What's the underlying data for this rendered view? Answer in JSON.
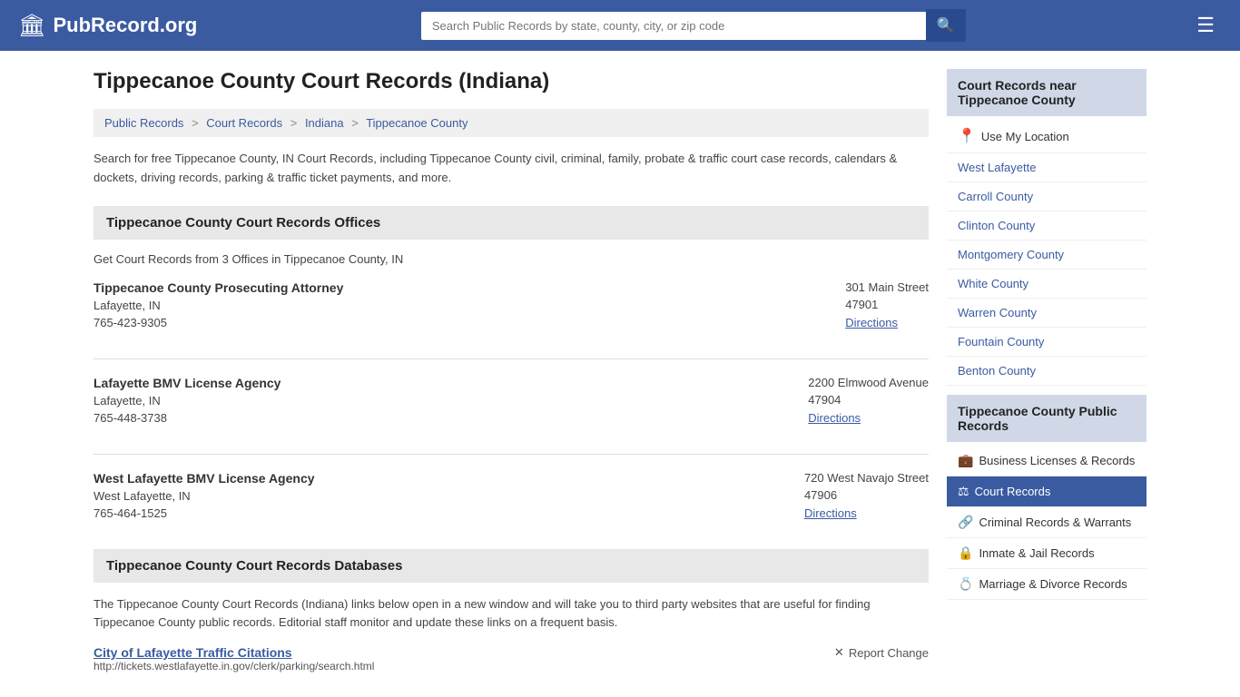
{
  "header": {
    "logo_icon": "🏛",
    "logo_text": "PubRecord.org",
    "search_placeholder": "Search Public Records by state, county, city, or zip code",
    "search_icon": "🔍",
    "menu_icon": "☰"
  },
  "page": {
    "title": "Tippecanoe County Court Records (Indiana)",
    "breadcrumb": [
      {
        "label": "Public Records",
        "href": "#"
      },
      {
        "label": "Court Records",
        "href": "#"
      },
      {
        "label": "Indiana",
        "href": "#"
      },
      {
        "label": "Tippecanoe County",
        "href": "#"
      }
    ],
    "description": "Search for free Tippecanoe County, IN Court Records, including Tippecanoe County civil, criminal, family, probate & traffic court case records, calendars & dockets, driving records, parking & traffic ticket payments, and more."
  },
  "offices_section": {
    "heading": "Tippecanoe County Court Records Offices",
    "count_text": "Get Court Records from 3 Offices in Tippecanoe County, IN",
    "offices": [
      {
        "name": "Tippecanoe County Prosecuting Attorney",
        "city": "Lafayette, IN",
        "phone": "765-423-9305",
        "address": "301 Main Street",
        "zip": "47901",
        "directions_label": "Directions"
      },
      {
        "name": "Lafayette BMV License Agency",
        "city": "Lafayette, IN",
        "phone": "765-448-3738",
        "address": "2200 Elmwood Avenue",
        "zip": "47904",
        "directions_label": "Directions"
      },
      {
        "name": "West Lafayette BMV License Agency",
        "city": "West Lafayette, IN",
        "phone": "765-464-1525",
        "address": "720 West Navajo Street",
        "zip": "47906",
        "directions_label": "Directions"
      }
    ]
  },
  "databases_section": {
    "heading": "Tippecanoe County Court Records Databases",
    "description": "The Tippecanoe County Court Records (Indiana) links below open in a new window and will take you to third party websites that are useful for finding Tippecanoe County public records. Editorial staff monitor and update these links on a frequent basis.",
    "first_link": {
      "title": "City of Lafayette Traffic Citations",
      "url": "http://tickets.westlafayette.in.gov/clerk/parking/search.html"
    },
    "report_change_label": "Report Change",
    "report_icon": "✕"
  },
  "sidebar": {
    "nearby_heading": "Court Records near Tippecanoe County",
    "use_location_label": "Use My Location",
    "nearby_locations": [
      "West Lafayette",
      "Carroll County",
      "Clinton County",
      "Montgomery County",
      "White County",
      "Warren County",
      "Fountain County",
      "Benton County"
    ],
    "public_records_heading": "Tippecanoe County Public Records",
    "public_records_items": [
      {
        "label": "Business Licenses & Records",
        "icon": "💼",
        "active": false
      },
      {
        "label": "Court Records",
        "icon": "⚖",
        "active": true
      },
      {
        "label": "Criminal Records & Warrants",
        "icon": "🔗",
        "active": false
      },
      {
        "label": "Inmate & Jail Records",
        "icon": "🔒",
        "active": false
      },
      {
        "label": "Marriage & Divorce Records",
        "icon": "💍",
        "active": false
      }
    ]
  }
}
